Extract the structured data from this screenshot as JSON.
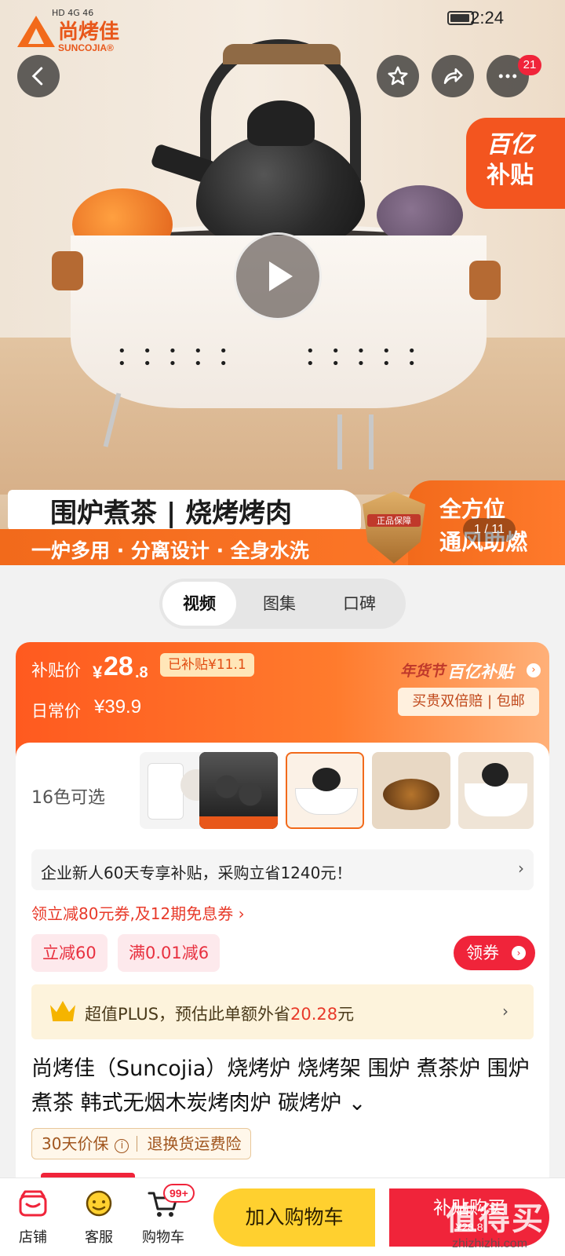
{
  "status_bar": {
    "signal_text": "HD 4G 46",
    "time": "2:24"
  },
  "brand": {
    "name_cn": "尚烤佳",
    "name_en": "SUNCOJIA®"
  },
  "header": {
    "notification_count": "21"
  },
  "hero": {
    "subsidy_tag_line1": "百亿",
    "subsidy_tag_line2": "补贴",
    "banner_top": "围炉煮茶 | 烧烤烤肉",
    "banner_bottom": "一炉多用 · 分离设计 · 全身水洗",
    "banner_right_line1": "全方位",
    "banner_right_line2": "通风助燃",
    "shield_text": "正品保障",
    "pager": "1 / 11"
  },
  "media_tabs": [
    {
      "label": "视频",
      "active": true
    },
    {
      "label": "图集",
      "active": false
    },
    {
      "label": "口碑",
      "active": false
    }
  ],
  "price": {
    "subsidy_label": "补贴价",
    "currency": "¥",
    "price_int": "28",
    "price_dec": ".8",
    "subsidized_amount": "已补贴¥11.1",
    "daily_label": "日常价",
    "daily_price": "¥39.9",
    "festival_label": "年货节",
    "program_label": "百亿补贴",
    "guarantee": "买贵双倍赔 | 包邮"
  },
  "variants": {
    "count_label": "16色可选"
  },
  "promo": {
    "enterprise_text": "企业新人60天专享补贴，采购立省1240元！",
    "coupon_line": "领立减80元券,及12期免息券 ›",
    "coupons": [
      "立减60",
      "满0.01减6"
    ],
    "claim_label": "领券"
  },
  "plus": {
    "prefix": "超值PLUS，预估此单额外省",
    "amount": "20.28",
    "suffix": "元"
  },
  "product": {
    "title": "尚烤佳（Suncojia）烧烤炉 烧烤架 围炉 煮茶炉 围炉煮茶 韩式无烟木炭烤肉炉 碳烤炉 ⌄"
  },
  "services": {
    "price_protect": "30天价保",
    "return_insurance": "退换货运费险"
  },
  "bottom_nav": {
    "store": "店铺",
    "service": "客服",
    "cart": "购物车",
    "cart_badge": "99+",
    "add_to_cart": "加入购物车",
    "buy_now": "补贴购买",
    "buy_price": "¥28.8"
  },
  "watermark": {
    "text": "值得买",
    "url": "zhizhizhi.com"
  },
  "colors": {
    "accent_orange": "#ff6a1f",
    "accent_red": "#f0243a",
    "accent_yellow": "#ffd02f"
  }
}
